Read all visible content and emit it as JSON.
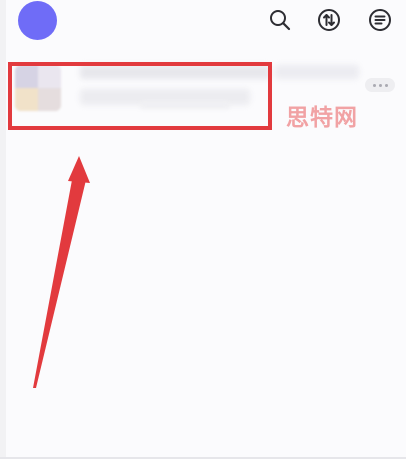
{
  "header": {
    "avatar_color": "#6f6cf7",
    "icons": [
      "search-icon",
      "sort-swap-icon",
      "menu-list-icon"
    ],
    "icon_color": "#2d2d33"
  },
  "chat_list": {
    "items": [
      {
        "avatar": "blurred-group-avatar",
        "name": "",
        "message": "",
        "more_icon": "ellipsis-icon"
      }
    ]
  },
  "annotation": {
    "box_color": "#e23a3e",
    "arrow_color": "#e23a3e",
    "watermark_text": "思特网",
    "watermark_color": "#ef8d8f"
  }
}
